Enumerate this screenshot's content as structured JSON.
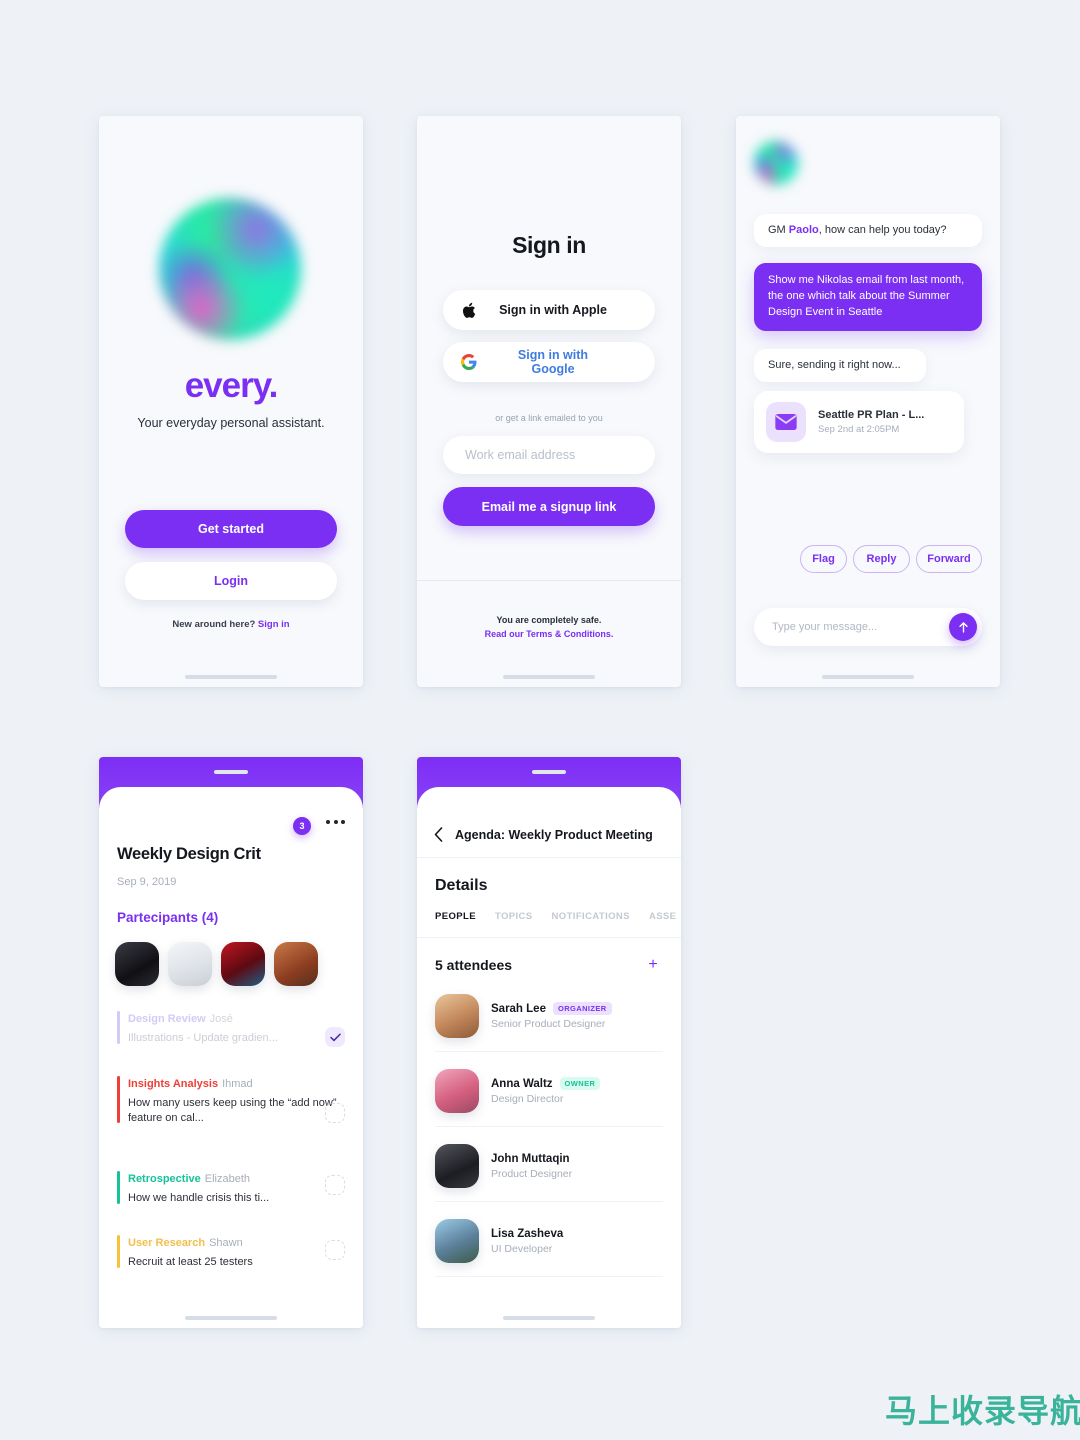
{
  "colors": {
    "accent": "#7b2ff2",
    "bg": "#eef2f7",
    "card": "#f7f9fc",
    "green": "#15c299",
    "red": "#ef3e36",
    "yellow": "#f5c33b"
  },
  "screen_welcome": {
    "logo_icon": "gradient-orb-logo",
    "brand": "every.",
    "tagline": "Your everyday personal assistant.",
    "get_started_label": "Get started",
    "login_label": "Login",
    "footer_text": "New around here?",
    "footer_link": "Sign in"
  },
  "screen_signin": {
    "title": "Sign in",
    "apple_label": "Sign in with Apple",
    "apple_icon": "apple-icon",
    "google_label": "Sign in with Google",
    "google_icon": "google-icon",
    "divider_text": "or get a link emailed to you",
    "email_placeholder": "Work email address",
    "email_value": "",
    "submit_label": "Email me a signup link",
    "safe_text": "You are completely safe.",
    "terms_link": "Read our Terms & Conditions."
  },
  "screen_chat": {
    "avatar_icon": "gradient-orb-avatar",
    "messages": [
      {
        "from": "bot",
        "prefix": "GM ",
        "highlight": "Paolo",
        "suffix": ", how can help you today?"
      },
      {
        "from": "user",
        "text": "Show me Nikolas email from last month, the one which talk about the Summer Design Event in Seattle"
      },
      {
        "from": "bot",
        "text": "Sure, sending it right now..."
      }
    ],
    "attachment": {
      "icon": "mail-icon",
      "title": "Seattle PR Plan - L...",
      "subtitle": "Sep 2nd at 2:05PM"
    },
    "actions": [
      "Flag",
      "Reply",
      "Forward"
    ],
    "input_placeholder": "Type your message...",
    "input_value": "",
    "send_icon": "arrow-up-icon"
  },
  "screen_meeting": {
    "badge_count": "3",
    "more_icon": "more-dots-icon",
    "title": "Weekly Design Crit",
    "date": "Sep 9, 2019",
    "participants_label": "Partecipants (4)",
    "participants": [
      {
        "name": "participant-1",
        "tone": "#1a1a1f"
      },
      {
        "name": "participant-2",
        "tone": "#eef0f2"
      },
      {
        "name": "participant-3",
        "tone": "#8a1418"
      },
      {
        "name": "participant-4",
        "tone": "#a65432"
      }
    ],
    "tasks": [
      {
        "label": "Design Review",
        "owner": "José",
        "desc": "Illustrations - Update gradien...",
        "color": "#a79cf0",
        "done": true,
        "faded": true
      },
      {
        "label": "Insights Analysis",
        "owner": "Ihmad",
        "desc": "How many users keep using the “add now” feature on cal...",
        "color": "#ef3e36",
        "done": false,
        "faded": false
      },
      {
        "label": "Retrospective",
        "owner": "Elizabeth",
        "desc": "How we handle crisis this ti...",
        "color": "#15c299",
        "done": false,
        "faded": false
      },
      {
        "label": "User Research",
        "owner": "Shawn",
        "desc": "Recruit at least 25 testers",
        "color": "#f5c33b",
        "done": false,
        "faded": true
      }
    ],
    "check_icon": "check-icon"
  },
  "screen_agenda": {
    "back_icon": "chevron-left-icon",
    "nav_title": "Agenda: Weekly Product Meeting",
    "section_title": "Details",
    "tabs": [
      "PEOPLE",
      "TOPICS",
      "NOTIFICATIONS",
      "ASSE"
    ],
    "active_tab": "PEOPLE",
    "attendees_count": "5 attendees",
    "add_icon": "plus-icon",
    "attendees": [
      {
        "name": "Sarah Lee",
        "tag": "ORGANIZER",
        "tag_type": "org",
        "role": "Senior Product Designer",
        "tone": "#d6b291"
      },
      {
        "name": "Anna Waltz",
        "tag": "OWNER",
        "tag_type": "own",
        "role": "Design Director",
        "tone": "#e4859c"
      },
      {
        "name": "John Muttaqin",
        "tag": "",
        "tag_type": "",
        "role": "Product Designer",
        "tone": "#2b2b30"
      },
      {
        "name": "Lisa Zasheva",
        "tag": "",
        "tag_type": "",
        "role": "UI Developer",
        "tone": "#7fb4d8"
      }
    ]
  },
  "watermark": {
    "text": "马上收录导航"
  }
}
